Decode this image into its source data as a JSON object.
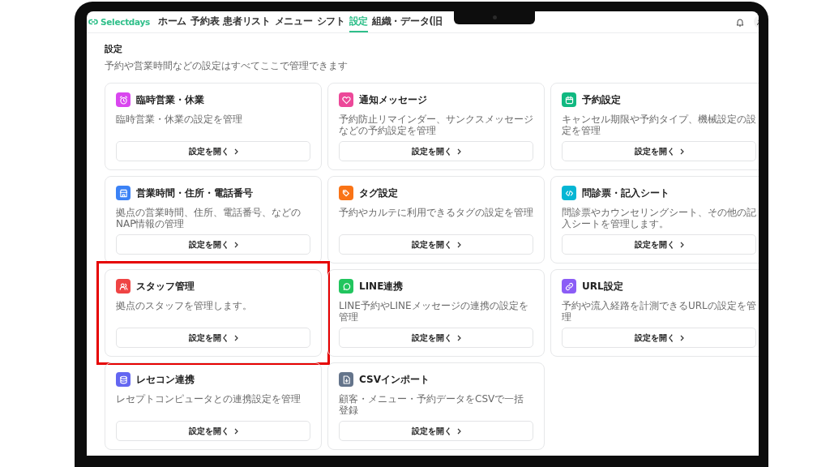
{
  "header": {
    "logo": "Selectdays",
    "nav": [
      {
        "label": "ホーム",
        "selected": false
      },
      {
        "label": "予約表",
        "selected": false
      },
      {
        "label": "患者リスト",
        "selected": false
      },
      {
        "label": "メニュー",
        "selected": false
      },
      {
        "label": "シフト",
        "selected": false
      },
      {
        "label": "設定",
        "selected": true
      },
      {
        "label": "組織・データ(旧",
        "selected": false
      }
    ]
  },
  "page": {
    "title": "設定",
    "subtitle": "予約や営業時間などの設定はすべてここで管理できます"
  },
  "cards": [
    {
      "kind": "alarm",
      "color": "#d946ef",
      "title": "臨時営業・休業",
      "description": "臨時営業・休業の設定を管理",
      "button": "設定を開く",
      "highlighted": false
    },
    {
      "kind": "heart",
      "color": "#ec4899",
      "title": "通知メッセージ",
      "description": "予約防止リマインダー、サンクスメッセージなどの予約設定を管理",
      "button": "設定を開く",
      "highlighted": false
    },
    {
      "kind": "calendar",
      "color": "#10b981",
      "title": "予約設定",
      "description": "キャンセル期限や予約タイプ、機械設定の設定を管理",
      "button": "設定を開く",
      "highlighted": false
    },
    {
      "kind": "store",
      "color": "#3b82f6",
      "title": "営業時間・住所・電話番号",
      "description": "拠点の営業時間、住所、電話番号、などのNAP情報の管理",
      "button": "設定を開く",
      "highlighted": false
    },
    {
      "kind": "tag",
      "color": "#f97316",
      "title": "タグ設定",
      "description": "予約やカルテに利用できるタグの設定を管理",
      "button": "設定を開く",
      "highlighted": false
    },
    {
      "kind": "code",
      "color": "#06b6d4",
      "title": "問診票・記入シート",
      "description": "問診票やカウンセリングシート、その他の記入シートを管理します。",
      "button": "設定を開く",
      "highlighted": false
    },
    {
      "kind": "users",
      "color": "#ef4444",
      "title": "スタッフ管理",
      "description": "拠点のスタッフを管理します。",
      "button": "設定を開く",
      "highlighted": true
    },
    {
      "kind": "chat",
      "color": "#22c55e",
      "title": "LINE連携",
      "description": "LINE予約やLINEメッセージの連携の設定を管理",
      "button": "設定を開く",
      "highlighted": false
    },
    {
      "kind": "link",
      "color": "#8b5cf6",
      "title": "URL設定",
      "description": "予約や流入経路を計測できるURLの設定を管理",
      "button": "設定を開く",
      "highlighted": false
    },
    {
      "kind": "database",
      "color": "#6366f1",
      "title": "レセコン連携",
      "description": "レセプトコンピュータとの連携設定を管理",
      "button": "設定を開く",
      "highlighted": false
    },
    {
      "kind": "file",
      "color": "#64748b",
      "title": "CSVインポート",
      "description": "顧客・メニュー・予約データをCSVで一括登録",
      "button": "設定を開く",
      "highlighted": false
    }
  ]
}
